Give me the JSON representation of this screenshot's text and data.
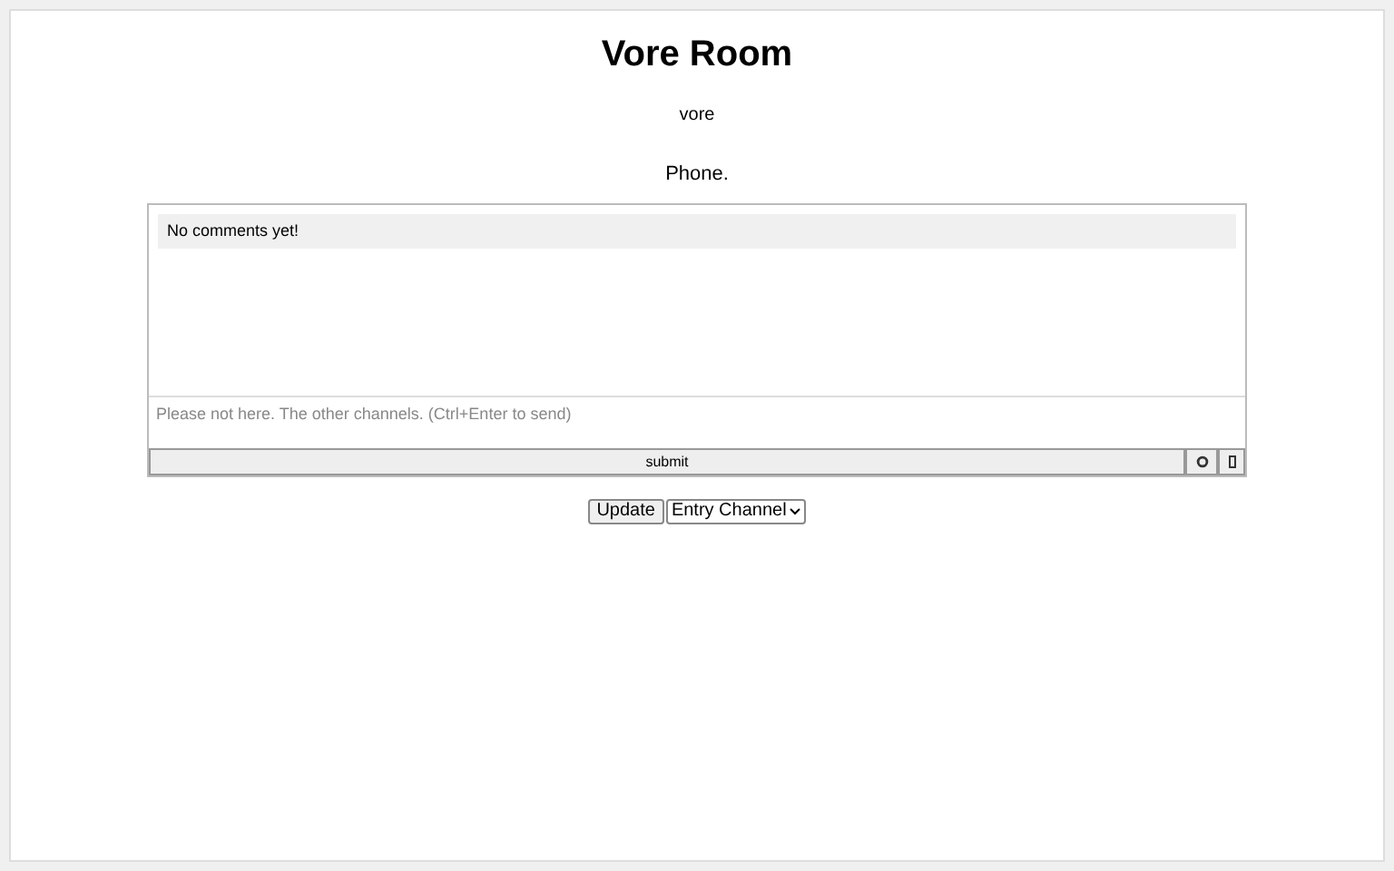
{
  "title": "Vore Room",
  "subtitle": "vore",
  "description": "Phone.",
  "comments": {
    "empty_message": "No comments yet!",
    "placeholder": "Please not here. The other channels. (Ctrl+Enter to send)",
    "submit": "submit"
  },
  "controls": {
    "update": "Update",
    "channel": "Entry Channel"
  }
}
